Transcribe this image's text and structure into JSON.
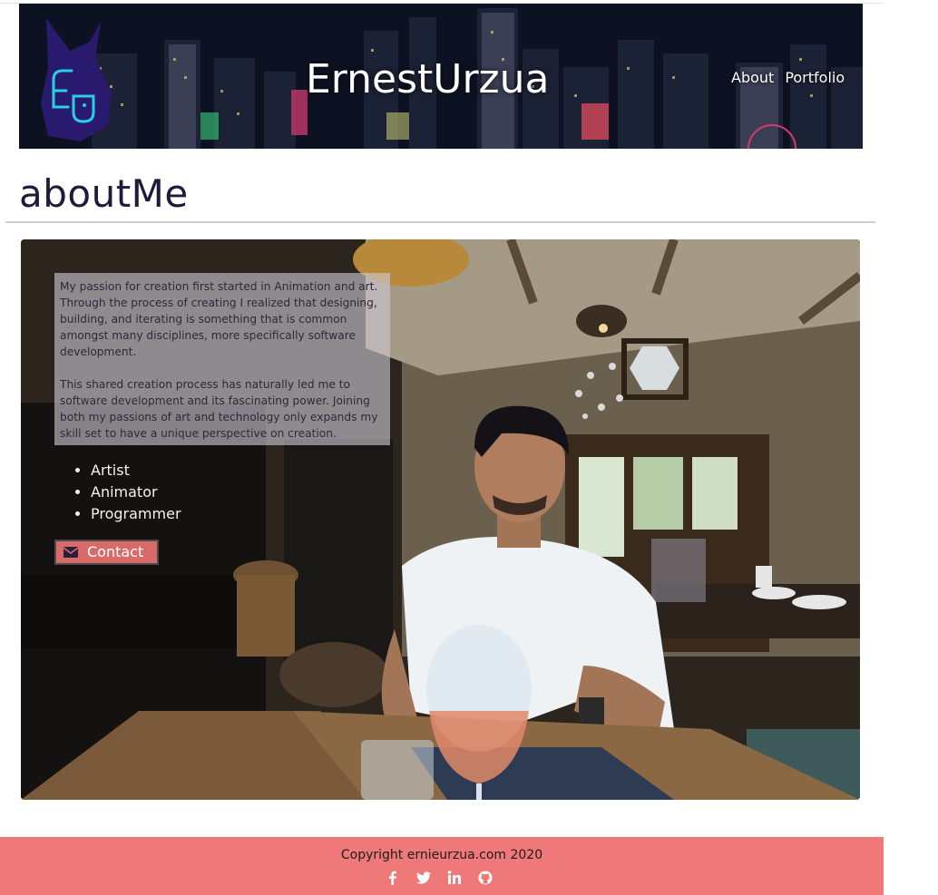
{
  "header": {
    "site_title": "ErnestUrzua",
    "nav": [
      {
        "label": "About"
      },
      {
        "label": "Portfolio"
      }
    ],
    "logo_colors": {
      "body": "#2a1a6e",
      "mark": "#26d0e8"
    }
  },
  "page": {
    "title": "aboutMe"
  },
  "about": {
    "paragraphs": [
      "My passion for creation first started in Animation and art. Through the process of creating I realized that designing, building, and iterating is something that is common amongst many disciplines, more specifically software development.",
      "This shared creation process has naturally led me to software development and its fascinating power. Joining both my passions of art and technology only expands my skill set to have a unique perspective on creation."
    ],
    "skills": [
      "Artist",
      "Animator",
      "Programmer"
    ],
    "contact_button": {
      "label": "Contact",
      "icon": "envelope-icon",
      "color": "#d96a6a"
    }
  },
  "footer": {
    "copyright": "Copyright ernieurzua.com 2020",
    "background": "#ef7878",
    "social": [
      {
        "icon": "facebook-icon"
      },
      {
        "icon": "twitter-icon"
      },
      {
        "icon": "linkedin-icon"
      },
      {
        "icon": "github-icon"
      }
    ]
  }
}
